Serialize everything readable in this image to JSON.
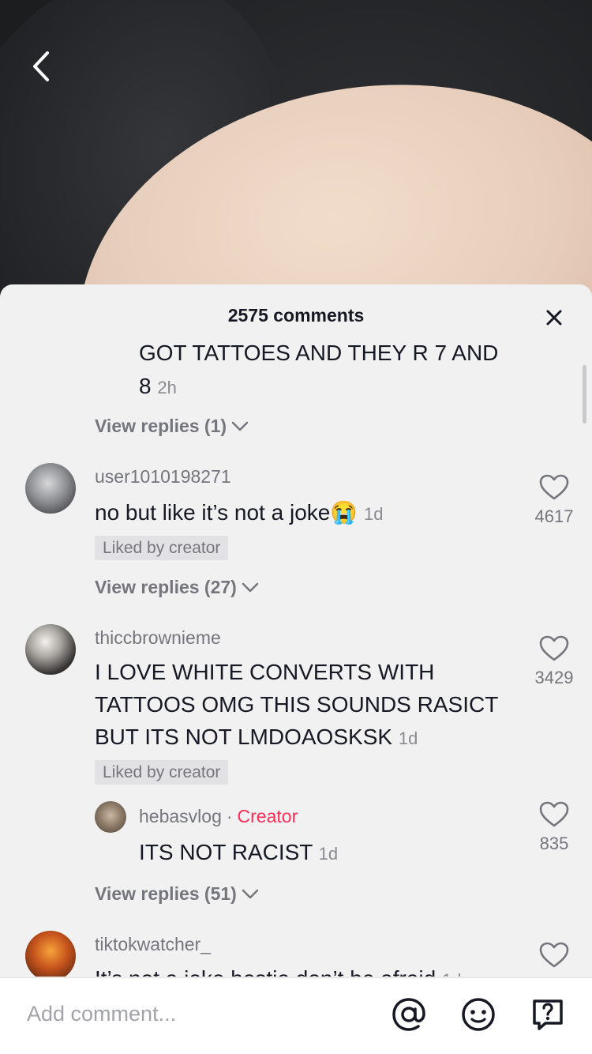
{
  "sheet": {
    "title": "2575 comments"
  },
  "comments": [
    {
      "text": "GOT TATTOES AND THEY R 7 AND",
      "text_line2": "8",
      "time": "2h",
      "view_replies": "View replies (1)"
    },
    {
      "username": "user1010198271",
      "text": "no but like it’s not a joke",
      "emoji": "😭",
      "time": "1d",
      "liked_by": "Liked by creator",
      "likes": "4617",
      "view_replies": "View replies (27)"
    },
    {
      "username": "thiccbrownieme",
      "lines": [
        "I LOVE WHITE CONVERTS WITH",
        "TATTOOS OMG THIS SOUNDS RASICT",
        "BUT ITS NOT LMDOAOSKSK"
      ],
      "time": "1d",
      "liked_by": "Liked by creator",
      "likes": "3429",
      "reply": {
        "username": "hebasvlog",
        "creator_label": "Creator",
        "text": "ITS NOT RACIST",
        "time": "1d",
        "likes": "835"
      },
      "view_replies": "View replies (51)"
    },
    {
      "username": "tiktokwatcher_",
      "text": "It’s not a joke bestie don’t be afraid",
      "time": "1d"
    }
  ],
  "input": {
    "placeholder": "Add comment..."
  },
  "icons": {
    "back": "chevron-left-icon",
    "close": "close-icon",
    "heart": "heart-icon",
    "at": "at-sign-icon",
    "emoji": "smiley-icon",
    "question": "question-box-icon"
  },
  "colors": {
    "creator": "#fe2c55",
    "sheet_bg": "#f1f1f2",
    "text": "#161823",
    "muted": "#75767c"
  }
}
